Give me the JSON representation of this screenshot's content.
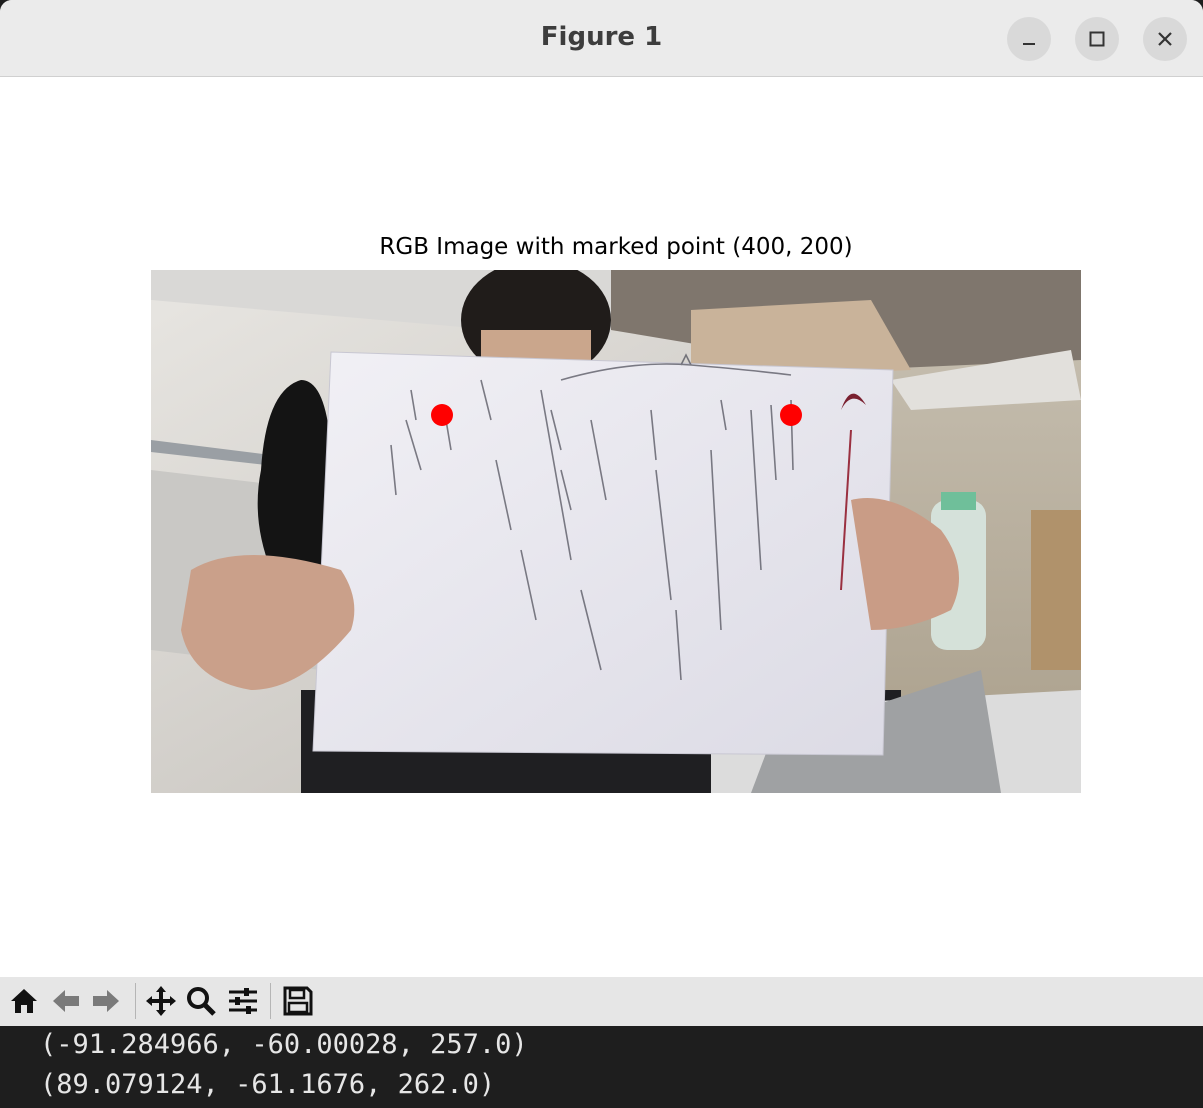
{
  "window": {
    "title": "Figure 1",
    "controls": {
      "minimize": "minimize-icon",
      "maximize": "maximize-icon",
      "close": "close-icon"
    }
  },
  "figure": {
    "axes_title": "RGB Image with marked point (400, 200)",
    "marked_point_color": "#ff0000"
  },
  "toolbar": {
    "buttons": [
      "home-icon",
      "back-arrow-icon",
      "forward-arrow-icon",
      "pan-icon",
      "zoom-icon",
      "configure-subplots-icon",
      "save-icon"
    ]
  },
  "terminal": {
    "lines": [
      "(-91.284966, -60.00028, 257.0)",
      "(89.079124, -61.1676, 262.0)"
    ]
  }
}
